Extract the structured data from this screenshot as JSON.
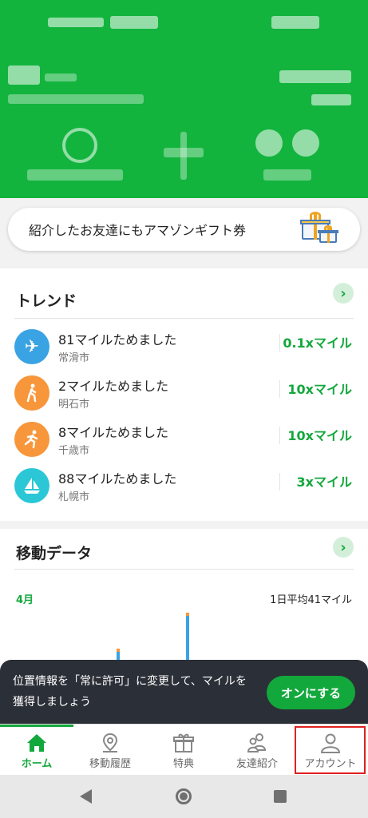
{
  "banner": {
    "text": "紹介したお友達にもアマゾンギフト券"
  },
  "trends": {
    "title": "トレンド",
    "items": [
      {
        "title": "81マイルためました",
        "city": "常滑市",
        "multiplier": "0.1xマイル",
        "icon": "airplane-icon",
        "color": "#3aa3e3"
      },
      {
        "title": "2マイルためました",
        "city": "明石市",
        "multiplier": "10xマイル",
        "icon": "walking-icon",
        "color": "#f7963a"
      },
      {
        "title": "8マイルためました",
        "city": "千歳市",
        "multiplier": "10xマイル",
        "icon": "running-icon",
        "color": "#f7963a"
      },
      {
        "title": "88マイルためました",
        "city": "札幌市",
        "multiplier": "3xマイル",
        "icon": "sailboat-icon",
        "color": "#2bc7d6"
      }
    ]
  },
  "movement": {
    "title": "移動データ",
    "month": "4月",
    "average": "1日平均41マイル"
  },
  "chart_data": {
    "type": "bar",
    "visible": "partially obscured by notification",
    "bars": [
      {
        "x_fraction": 0.32,
        "relative_height": 0.25
      },
      {
        "x_fraction": 0.51,
        "relative_height": 1.0
      }
    ],
    "colors": [
      "#3aa3e3",
      "#f7963a"
    ]
  },
  "toast": {
    "message": "位置情報を「常に許可」に変更して、マイルを獲得しましょう",
    "button": "オンにする"
  },
  "tabs": [
    {
      "label": "ホーム",
      "icon": "home-icon",
      "active": true
    },
    {
      "label": "移動履歴",
      "icon": "map-pin-icon",
      "active": false
    },
    {
      "label": "特典",
      "icon": "gift-icon",
      "active": false
    },
    {
      "label": "友達紹介",
      "icon": "friends-icon",
      "active": false
    },
    {
      "label": "アカウント",
      "icon": "account-icon",
      "active": false
    }
  ],
  "colors": {
    "brand": "#13b43e",
    "accent_text": "#13a83c",
    "toast_bg": "#2b2f37",
    "highlight": "#e02020"
  }
}
